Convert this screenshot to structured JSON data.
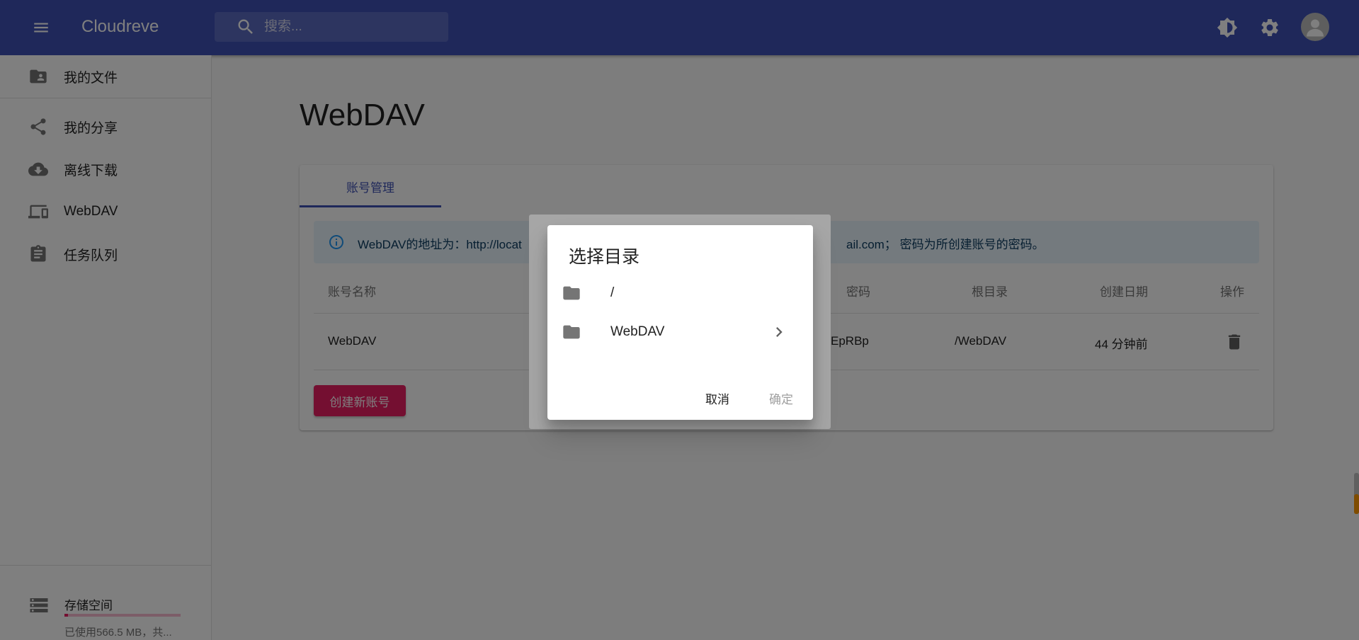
{
  "appbar": {
    "title": "Cloudreve",
    "search_placeholder": "搜索...",
    "icons": [
      "menu-icon",
      "search-icon",
      "brightness-icon",
      "gear-icon",
      "account-icon"
    ]
  },
  "sidebar": {
    "items": [
      {
        "label": "我的文件",
        "icon": "folder-account-icon"
      },
      {
        "label": "我的分享",
        "icon": "share-icon"
      },
      {
        "label": "离线下载",
        "icon": "cloud-download-icon"
      },
      {
        "label": "WebDAV",
        "icon": "devices-icon"
      },
      {
        "label": "任务队列",
        "icon": "clipboard-icon"
      }
    ],
    "storage": {
      "title": "存储空间",
      "description": "已使用566.5 MB，共...",
      "used_fraction": 0.03
    }
  },
  "main": {
    "page_title": "WebDAV",
    "tab_label": "账号管理",
    "info_text_left": "WebDAV的地址为：http://locat",
    "info_text_right": "ail.com； 密码为所创建账号的密码。",
    "table": {
      "headers": [
        "账号名称",
        "密码",
        "根目录",
        "创建日期",
        "操作"
      ],
      "rows": [
        {
          "name": "WebDAV",
          "password": "EpRBp",
          "root": "/WebDAV",
          "created": "44 分钟前"
        }
      ]
    },
    "create_button": "创建新账号"
  },
  "dialog": {
    "title": "选择目录",
    "items": [
      {
        "label": "/",
        "has_children": false
      },
      {
        "label": "WebDAV",
        "has_children": true
      }
    ],
    "cancel_label": "取消",
    "confirm_label": "确定"
  },
  "colors": {
    "primary": "#3f51b5",
    "secondary": "#e91e63",
    "info_bg": "#e8f4fd",
    "info_icon": "#2196f3",
    "overlay": "rgba(0,0,0,0.5)",
    "scrollbar_accent": "#ff9800"
  }
}
